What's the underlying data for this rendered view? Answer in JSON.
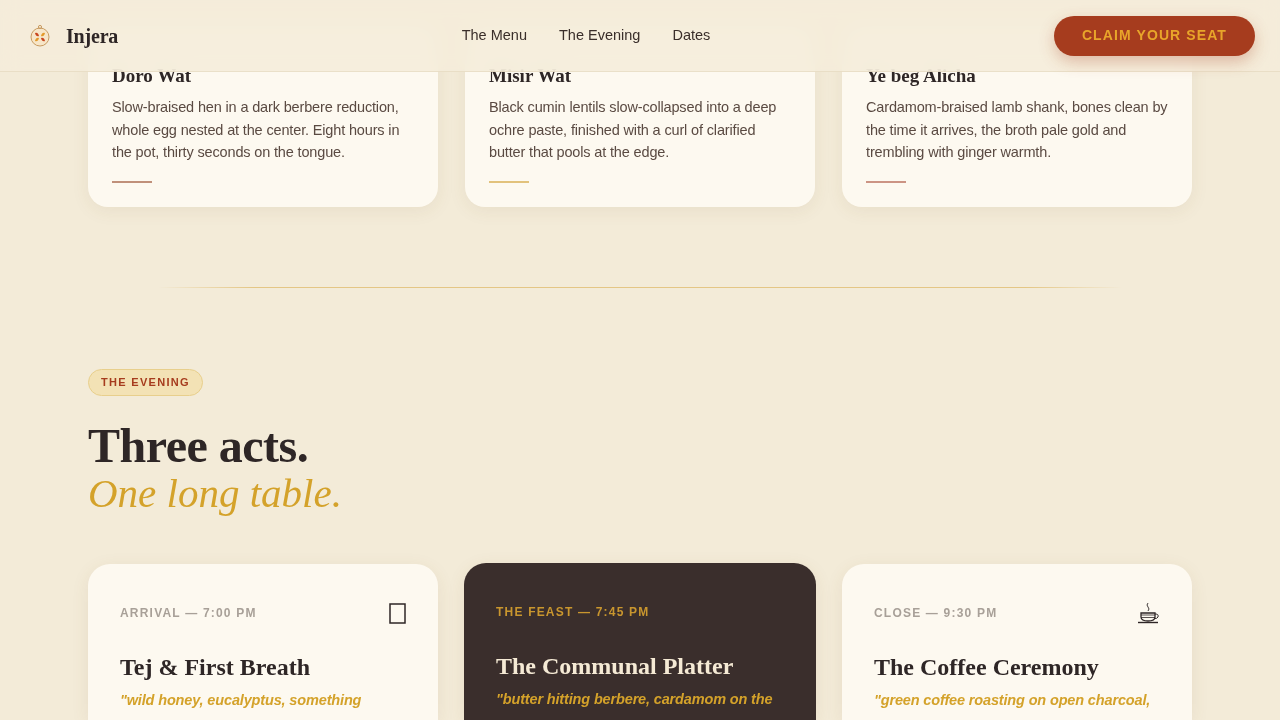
{
  "navbar": {
    "brand": "Injera",
    "links": [
      {
        "label": "The Menu"
      },
      {
        "label": "The Evening"
      },
      {
        "label": "Dates"
      }
    ],
    "cta": "CLAIM YOUR SEAT"
  },
  "dishes": [
    {
      "name": "Doro Wat",
      "description": "Slow-braised hen in a dark berbere reduction, whole egg nested at the center. Eight hours in the pot, thirty seconds on the tongue.",
      "color": "#c0907a"
    },
    {
      "name": "Misir Wat",
      "description": "Black cumin lentils slow-collapsed into a deep ochre paste, finished with a curl of clarified butter that pools at the edge.",
      "color": "#e2c27c"
    },
    {
      "name": "Ye beg Alicha",
      "description": "Cardamom-braised lamb shank, bones clean by the time it arrives, the broth pale gold and trembling with ginger warmth.",
      "color": "#cc9484"
    }
  ],
  "evening": {
    "badge": "THE EVENING",
    "heading": "Three acts.",
    "subheading": "One long table.",
    "acts": [
      {
        "kind": "light",
        "time": "ARRIVAL — 7:00 PM",
        "title": "Tej & First Breath",
        "quote": "\"wild honey, eucalyptus, something"
      },
      {
        "kind": "dark",
        "time": "THE FEAST — 7:45 PM",
        "title": "The Communal Platter",
        "quote": "\"butter hitting berbere, cardamom on the"
      },
      {
        "kind": "light",
        "time": "CLOSE — 9:30 PM",
        "title": "The Coffee Ceremony",
        "quote": "\"green coffee roasting on open charcoal,"
      }
    ]
  }
}
